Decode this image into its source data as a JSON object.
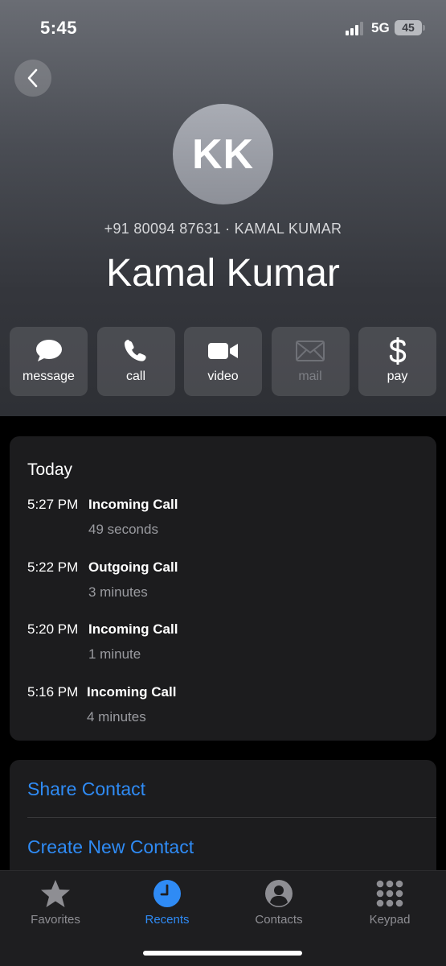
{
  "status_bar": {
    "time": "5:45",
    "network": "5G",
    "battery": "45"
  },
  "contact": {
    "initials": "KK",
    "subtitle": "+91 80094 87631 · KAMAL KUMAR",
    "name": "Kamal Kumar"
  },
  "actions": [
    {
      "label": "message",
      "icon": "message-bubble-icon",
      "enabled": true
    },
    {
      "label": "call",
      "icon": "phone-icon",
      "enabled": true
    },
    {
      "label": "video",
      "icon": "video-camera-icon",
      "enabled": true
    },
    {
      "label": "mail",
      "icon": "envelope-icon",
      "enabled": false
    },
    {
      "label": "pay",
      "icon": "dollar-icon",
      "enabled": true
    }
  ],
  "recents": {
    "heading": "Today",
    "calls": [
      {
        "time": "5:27 PM",
        "type": "Incoming Call",
        "duration": "49 seconds"
      },
      {
        "time": "5:22 PM",
        "type": "Outgoing Call",
        "duration": "3 minutes"
      },
      {
        "time": "5:20 PM",
        "type": "Incoming Call",
        "duration": "1 minute"
      },
      {
        "time": "5:16 PM",
        "type": "Incoming Call",
        "duration": "4 minutes"
      }
    ]
  },
  "links": {
    "share": "Share Contact",
    "create": "Create New Contact"
  },
  "tabs": [
    {
      "label": "Favorites",
      "icon": "star-icon",
      "active": false
    },
    {
      "label": "Recents",
      "icon": "clock-icon",
      "active": true
    },
    {
      "label": "Contacts",
      "icon": "person-circle-icon",
      "active": false
    },
    {
      "label": "Keypad",
      "icon": "keypad-icon",
      "active": false
    }
  ],
  "colors": {
    "accent": "#2f8bf5",
    "card": "#1c1c1e",
    "background": "#000000"
  }
}
